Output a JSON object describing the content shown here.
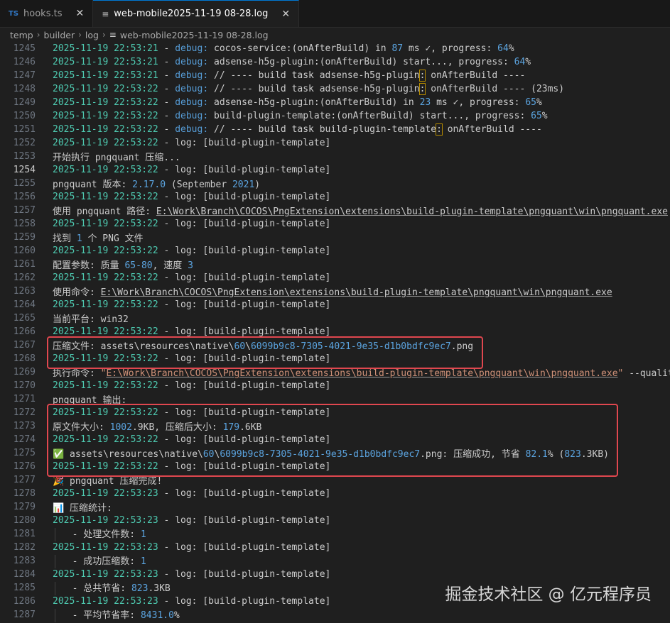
{
  "tabs": [
    {
      "icon_text": "TS",
      "label": "hooks.ts",
      "close": "✕"
    },
    {
      "icon_text": "≡",
      "label": "web-mobile2025-11-19 08-28.log",
      "close": "✕"
    }
  ],
  "breadcrumb": [
    "temp",
    "builder",
    "log",
    "web-mobile2025-11-19 08-28.log"
  ],
  "current_line": 1254,
  "log_lines": [
    {
      "n": 1245,
      "parts": [
        [
          "ts",
          "2025-11-19 22:53:21"
        ],
        [
          "t",
          " - "
        ],
        [
          "dbg",
          "debug:"
        ],
        [
          "t",
          " cocos-service:(onAfterBuild) in "
        ],
        [
          "num",
          "87"
        ],
        [
          "t",
          " ms ✓, progress: "
        ],
        [
          "num",
          "64"
        ],
        [
          "t",
          "%"
        ]
      ]
    },
    {
      "n": 1246,
      "parts": [
        [
          "ts",
          "2025-11-19 22:53:21"
        ],
        [
          "t",
          " - "
        ],
        [
          "dbg",
          "debug:"
        ],
        [
          "t",
          " adsense-h5g-plugin:(onAfterBuild) start..., progress: "
        ],
        [
          "num",
          "64"
        ],
        [
          "t",
          "%"
        ]
      ]
    },
    {
      "n": 1247,
      "parts": [
        [
          "ts",
          "2025-11-19 22:53:21"
        ],
        [
          "t",
          " - "
        ],
        [
          "dbg",
          "debug:"
        ],
        [
          "t",
          " // ---- build task adsense-h5g-plugin"
        ],
        [
          "hl",
          ":"
        ],
        [
          "t",
          " onAfterBuild ----"
        ]
      ]
    },
    {
      "n": 1248,
      "parts": [
        [
          "ts",
          "2025-11-19 22:53:22"
        ],
        [
          "t",
          " - "
        ],
        [
          "dbg",
          "debug:"
        ],
        [
          "t",
          " // ---- build task adsense-h5g-plugin"
        ],
        [
          "hl",
          ":"
        ],
        [
          "t",
          " onAfterBuild ---- (23ms)"
        ]
      ]
    },
    {
      "n": 1249,
      "parts": [
        [
          "ts",
          "2025-11-19 22:53:22"
        ],
        [
          "t",
          " - "
        ],
        [
          "dbg",
          "debug:"
        ],
        [
          "t",
          " adsense-h5g-plugin:(onAfterBuild) in "
        ],
        [
          "num",
          "23"
        ],
        [
          "t",
          " ms ✓, progress: "
        ],
        [
          "num",
          "65"
        ],
        [
          "t",
          "%"
        ]
      ]
    },
    {
      "n": 1250,
      "parts": [
        [
          "ts",
          "2025-11-19 22:53:22"
        ],
        [
          "t",
          " - "
        ],
        [
          "dbg",
          "debug:"
        ],
        [
          "t",
          " build-plugin-template:(onAfterBuild) start..., progress: "
        ],
        [
          "num",
          "65"
        ],
        [
          "t",
          "%"
        ]
      ]
    },
    {
      "n": 1251,
      "parts": [
        [
          "ts",
          "2025-11-19 22:53:22"
        ],
        [
          "t",
          " - "
        ],
        [
          "dbg",
          "debug:"
        ],
        [
          "t",
          " // ---- build task build-plugin-template"
        ],
        [
          "hl",
          ":"
        ],
        [
          "t",
          " onAfterBuild ----"
        ]
      ]
    },
    {
      "n": 1252,
      "parts": [
        [
          "ts",
          "2025-11-19 22:53:22"
        ],
        [
          "t",
          " - log: [build-plugin-template]"
        ]
      ]
    },
    {
      "n": 1253,
      "parts": [
        [
          "t",
          "开始执行 pngquant 压缩..."
        ]
      ]
    },
    {
      "n": 1254,
      "parts": [
        [
          "ts",
          "2025-11-19 22:53:22"
        ],
        [
          "t",
          " - log: [build-plugin-template]"
        ]
      ]
    },
    {
      "n": 1255,
      "parts": [
        [
          "t",
          "pngquant 版本: "
        ],
        [
          "num",
          "2.17.0"
        ],
        [
          "t",
          " (September "
        ],
        [
          "num",
          "2021"
        ],
        [
          "t",
          ")"
        ]
      ]
    },
    {
      "n": 1256,
      "parts": [
        [
          "ts",
          "2025-11-19 22:53:22"
        ],
        [
          "t",
          " - log: [build-plugin-template]"
        ]
      ]
    },
    {
      "n": 1257,
      "parts": [
        [
          "t",
          "使用 pngquant 路径: "
        ],
        [
          "path",
          "E:\\Work\\Branch\\COCOS\\PngExtension\\extensions\\build-plugin-template\\pngquant\\win\\pngquant.exe"
        ]
      ]
    },
    {
      "n": 1258,
      "parts": [
        [
          "ts",
          "2025-11-19 22:53:22"
        ],
        [
          "t",
          " - log: [build-plugin-template]"
        ]
      ]
    },
    {
      "n": 1259,
      "parts": [
        [
          "t",
          "找到 "
        ],
        [
          "num",
          "1"
        ],
        [
          "t",
          " 个 PNG 文件"
        ]
      ]
    },
    {
      "n": 1260,
      "parts": [
        [
          "ts",
          "2025-11-19 22:53:22"
        ],
        [
          "t",
          " - log: [build-plugin-template]"
        ]
      ]
    },
    {
      "n": 1261,
      "parts": [
        [
          "t",
          "配置参数: 质量 "
        ],
        [
          "num",
          "65-80"
        ],
        [
          "t",
          ", 速度 "
        ],
        [
          "num",
          "3"
        ]
      ]
    },
    {
      "n": 1262,
      "parts": [
        [
          "ts",
          "2025-11-19 22:53:22"
        ],
        [
          "t",
          " - log: [build-plugin-template]"
        ]
      ]
    },
    {
      "n": 1263,
      "parts": [
        [
          "t",
          "使用命令: "
        ],
        [
          "path",
          "E:\\Work\\Branch\\COCOS\\PngExtension\\extensions\\build-plugin-template\\pngquant\\win\\pngquant.exe"
        ]
      ]
    },
    {
      "n": 1264,
      "parts": [
        [
          "ts",
          "2025-11-19 22:53:22"
        ],
        [
          "t",
          " - log: [build-plugin-template]"
        ]
      ]
    },
    {
      "n": 1265,
      "parts": [
        [
          "t",
          "当前平台: win32"
        ]
      ]
    },
    {
      "n": 1266,
      "parts": [
        [
          "ts",
          "2025-11-19 22:53:22"
        ],
        [
          "t",
          " - log: [build-plugin-template]"
        ]
      ]
    },
    {
      "n": 1267,
      "parts": [
        [
          "t",
          "压缩文件: assets\\resources\\native\\"
        ],
        [
          "num",
          "60"
        ],
        [
          "t",
          "\\"
        ],
        [
          "num",
          "6099b9c8-7305-4021-9e35-d1b0bdfc9ec7"
        ],
        [
          "t",
          ".png"
        ]
      ]
    },
    {
      "n": 1268,
      "parts": [
        [
          "ts",
          "2025-11-19 22:53:22"
        ],
        [
          "t",
          " - log: [build-plugin-template]"
        ]
      ]
    },
    {
      "n": 1269,
      "parts": [
        [
          "t",
          "执行命令: "
        ],
        [
          "str",
          "\""
        ],
        [
          "path_str",
          "E:\\Work\\Branch\\COCOS\\PngExtension\\extensions\\build-plugin-template\\pngquant\\win\\pngquant.exe"
        ],
        [
          "str",
          "\""
        ],
        [
          "t",
          " --quality"
        ]
      ]
    },
    {
      "n": 1270,
      "parts": [
        [
          "ts",
          "2025-11-19 22:53:22"
        ],
        [
          "t",
          " - log: [build-plugin-template]"
        ]
      ]
    },
    {
      "n": 1271,
      "parts": [
        [
          "t",
          "pngquant 输出:"
        ]
      ]
    },
    {
      "n": 1272,
      "parts": [
        [
          "ts",
          "2025-11-19 22:53:22"
        ],
        [
          "t",
          " - log: [build-plugin-template]"
        ]
      ]
    },
    {
      "n": 1273,
      "parts": [
        [
          "t",
          "原文件大小: "
        ],
        [
          "num",
          "1002"
        ],
        [
          "t",
          ".9KB, 压缩后大小: "
        ],
        [
          "num",
          "179"
        ],
        [
          "t",
          ".6KB"
        ]
      ]
    },
    {
      "n": 1274,
      "parts": [
        [
          "ts",
          "2025-11-19 22:53:22"
        ],
        [
          "t",
          " - log: [build-plugin-template]"
        ]
      ]
    },
    {
      "n": 1275,
      "parts": [
        [
          "t",
          "✅ assets\\resources\\native\\"
        ],
        [
          "num",
          "60"
        ],
        [
          "t",
          "\\"
        ],
        [
          "num",
          "6099b9c8-7305-4021-9e35-d1b0bdfc9ec7"
        ],
        [
          "t",
          ".png: 压缩成功, 节省 "
        ],
        [
          "num",
          "82.1"
        ],
        [
          "t",
          "% ("
        ],
        [
          "num",
          "823"
        ],
        [
          "t",
          ".3KB)"
        ]
      ]
    },
    {
      "n": 1276,
      "parts": [
        [
          "ts",
          "2025-11-19 22:53:22"
        ],
        [
          "t",
          " - log: [build-plugin-template]"
        ]
      ]
    },
    {
      "n": 1277,
      "parts": [
        [
          "t",
          "🎉 pngquant 压缩完成!"
        ]
      ]
    },
    {
      "n": 1278,
      "parts": [
        [
          "ts",
          "2025-11-19 22:53:23"
        ],
        [
          "t",
          " - log: [build-plugin-template]"
        ]
      ]
    },
    {
      "n": 1279,
      "parts": [
        [
          "t",
          "📊 压缩统计:"
        ]
      ]
    },
    {
      "n": 1280,
      "parts": [
        [
          "ts",
          "2025-11-19 22:53:23"
        ],
        [
          "t",
          " - log: [build-plugin-template]"
        ]
      ]
    },
    {
      "n": 1281,
      "parts": [
        [
          "guide",
          ""
        ],
        [
          "t",
          "  - 处理文件数: "
        ],
        [
          "num",
          "1"
        ]
      ]
    },
    {
      "n": 1282,
      "parts": [
        [
          "ts",
          "2025-11-19 22:53:23"
        ],
        [
          "t",
          " - log: [build-plugin-template]"
        ]
      ]
    },
    {
      "n": 1283,
      "parts": [
        [
          "guide",
          ""
        ],
        [
          "t",
          "  - 成功压缩数: "
        ],
        [
          "num",
          "1"
        ]
      ]
    },
    {
      "n": 1284,
      "parts": [
        [
          "ts",
          "2025-11-19 22:53:23"
        ],
        [
          "t",
          " - log: [build-plugin-template]"
        ]
      ]
    },
    {
      "n": 1285,
      "parts": [
        [
          "guide",
          ""
        ],
        [
          "t",
          "  - 总共节省: "
        ],
        [
          "num",
          "823"
        ],
        [
          "t",
          ".3KB"
        ]
      ]
    },
    {
      "n": 1286,
      "parts": [
        [
          "ts",
          "2025-11-19 22:53:23"
        ],
        [
          "t",
          " - log: [build-plugin-template]"
        ]
      ]
    },
    {
      "n": 1287,
      "parts": [
        [
          "guide",
          ""
        ],
        [
          "t",
          "  - 平均节省率: "
        ],
        [
          "num",
          "8431.0"
        ],
        [
          "t",
          "%"
        ]
      ]
    }
  ],
  "highlight_boxes": [
    {
      "from_line": 1267,
      "to_line": 1268
    },
    {
      "from_line": 1272,
      "to_line": 1276
    }
  ],
  "watermark": "掘金技术社区 @ 亿元程序员",
  "colors": {
    "timestamp": "#4ec9b0",
    "debug": "#569cd6",
    "number": "#5ba4e0",
    "string": "#ce9178",
    "highlight_box": "#e0474f"
  }
}
